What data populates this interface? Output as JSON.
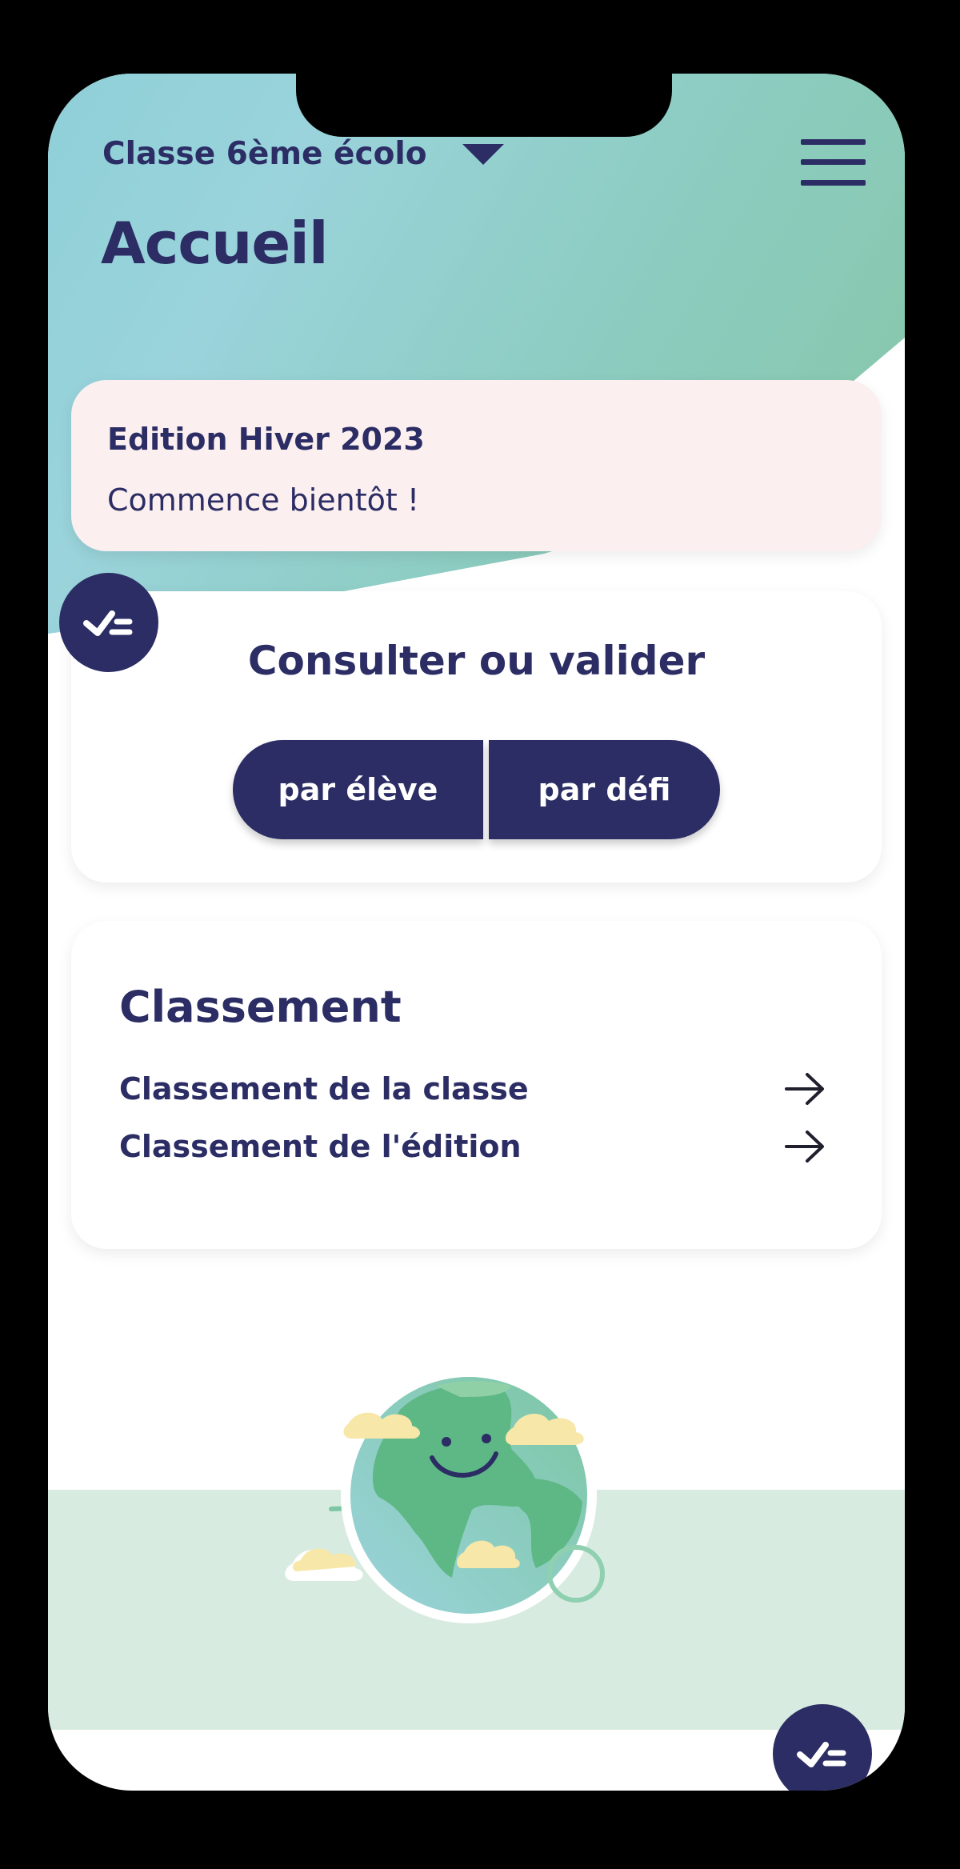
{
  "header": {
    "class_selector_label": "Classe 6ème écolo",
    "page_title": "Accueil"
  },
  "edition": {
    "title": "Edition Hiver 2023",
    "status": "Commence bientôt !"
  },
  "validate": {
    "title": "Consulter ou valider",
    "by_student_label": "par élève",
    "by_challenge_label": "par défi"
  },
  "ranking": {
    "title": "Classement",
    "items": [
      {
        "label": "Classement de la classe"
      },
      {
        "label": "Classement de l'édition"
      }
    ]
  },
  "icons": {
    "menu": "hamburger-menu-icon",
    "caret": "caret-down-icon",
    "validate": "check-list-icon",
    "arrow": "arrow-right-icon",
    "illustration": "smiling-earth-illustration"
  },
  "colors": {
    "primary": "#2b2d64",
    "header_gradient_start": "#9ad3db",
    "header_gradient_end": "#86c6a6",
    "edition_card_bg": "#fbefef",
    "ground_band": "#d8ebe1"
  }
}
